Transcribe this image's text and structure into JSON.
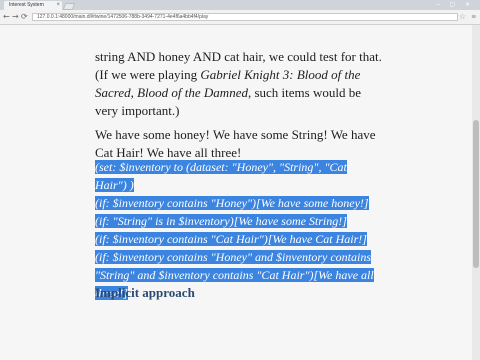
{
  "browser": {
    "tab_title": "Interest System",
    "tab_close": "×",
    "window_controls": "– ▢ ✕",
    "url": "127.0.0.1:48000/main.dll#twine/1472506-788b-3494-7271-4e4f6a4bb4f4/play",
    "back": "←",
    "forward": "→",
    "reload": "⟳",
    "star": "☆",
    "menu": "≡"
  },
  "content": {
    "para1_pre": "string AND honey AND cat hair, we could test for that. (If we were playing ",
    "para1_italic": "Gabriel Knight 3: Blood of the Sacred, Blood of the Damned",
    "para1_post": ", such items would be very important.)",
    "para2": "We have some honey! We have some String! We have Cat Hair! We have all three!",
    "code_lines": [
      "(set: $inventory to (dataset: \"Honey\", \"String\", \"Cat Hair\") )",
      "(if: $inventory contains \"Honey\")[We have some honey!]",
      "(if: \"String\" is in $inventory)[We have some String!]",
      "(if: $inventory contains \"Cat Hair\")[We have Cat Hair!]",
      "(if: $inventory contains \"Honey\" and $inventory contains",
      "\"String\" and $inventory contains \"Cat Hair\")[We have all",
      "three!]"
    ],
    "heading": "Implicit approach"
  },
  "colors": {
    "selection": "#3b84e0",
    "heading": "#2b4a73",
    "text": "#1e1e1e"
  }
}
